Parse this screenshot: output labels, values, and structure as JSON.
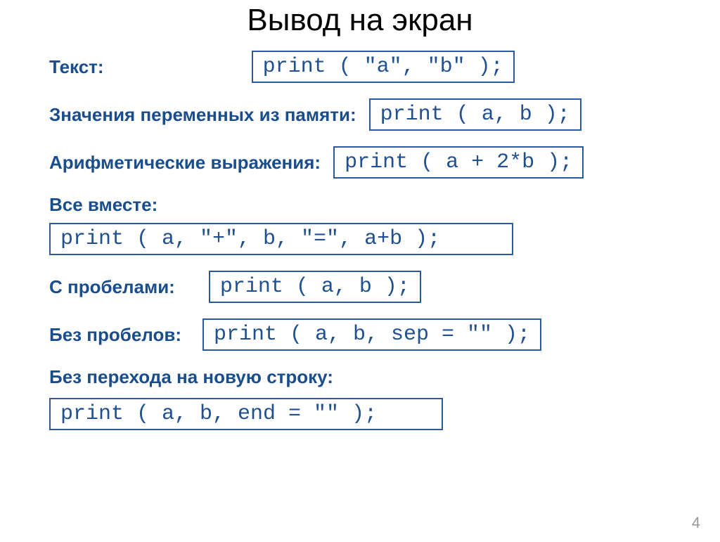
{
  "title": "Вывод на экран",
  "rows": {
    "text": {
      "label": "Текст:",
      "code": "print ( \"a\", \"b\" );"
    },
    "vars": {
      "label": "Значения переменных из памяти:",
      "code": "print ( a, b );"
    },
    "expr": {
      "label": "Арифметические выражения:",
      "code": "print ( a + 2*b );"
    },
    "all": {
      "label": "Все вместе:",
      "code": "print ( a, \"+\", b, \"=\",  a+b );"
    },
    "withspaces": {
      "label": "С пробелами:",
      "code": "print ( a, b );"
    },
    "nospaces": {
      "label": "Без пробелов:",
      "code": "print ( a, b, sep = \"\" );"
    },
    "nonewline": {
      "label": "Без перехода на новую строку:",
      "code": "print ( a, b, end = \"\" );"
    }
  },
  "page_number": "4"
}
